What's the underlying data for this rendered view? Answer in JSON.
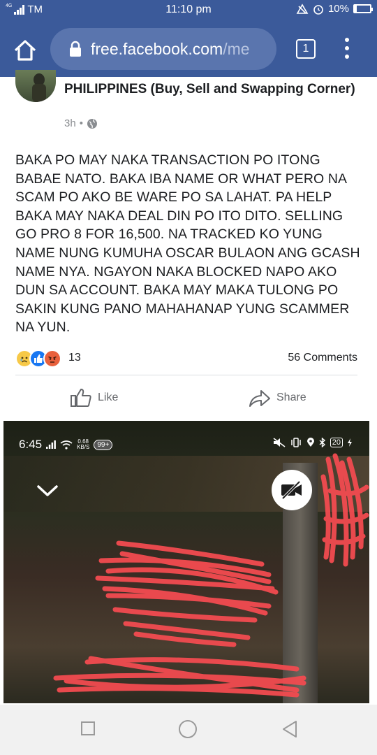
{
  "status_bar": {
    "network_badge": "4G",
    "carrier": "TM",
    "time": "11:10 pm",
    "battery": "10%",
    "icons": [
      "signal-icon",
      "data-saver-icon",
      "alarm-icon",
      "battery-icon"
    ]
  },
  "browser": {
    "url_host": "free.facebook.com",
    "url_rest": "/me",
    "tab_count": "1",
    "icons": [
      "home-icon",
      "lock-icon",
      "tabs-icon",
      "more-vert-icon"
    ]
  },
  "post": {
    "group_name": "PHILIPPINES (Buy, Sell and Swapping Corner)",
    "time_ago": "3h",
    "separator": "•",
    "body": "BAKA PO MAY NAKA TRANSACTION PO ITONG BABAE NATO. BAKA IBA NAME OR WHAT PERO NA SCAM PO AKO BE WARE PO SA LAHAT. PA HELP BAKA MAY NAKA DEAL DIN PO ITO DITO. SELLING GO PRO 8 FOR 16,500. NA TRACKED KO YUNG NAME NUNG KUMUHA OSCAR BULAON ANG GCASH NAME NYA. NGAYON NAKA BLOCKED NAPO AKO DUN SA ACCOUNT. BAKA MAY MAKA TULONG PO SAKIN KUNG PANO MAHAHANAP YUNG SCAMMER NA YUN.",
    "reaction_count": "13",
    "comments": "56 Comments",
    "like_label": "Like",
    "share_label": "Share",
    "reaction_icons": [
      "sad-icon",
      "like-icon",
      "angry-icon"
    ]
  },
  "screenshot_image": {
    "time": "6:45",
    "speed_value": "0.68",
    "speed_unit": "KB/S",
    "notif_badge": "99+",
    "battery": "20",
    "icons": [
      "mute-icon",
      "vibrate-icon",
      "location-icon",
      "bluetooth-icon",
      "chevron-down-icon",
      "video-off-icon"
    ]
  },
  "colors": {
    "facebook_blue": "#3b5a9a",
    "url_bar": "#5a75ae",
    "scribble_red": "#f24b50",
    "text_dark": "#1c1e21",
    "text_gray": "#65676b"
  },
  "nav": {
    "icons": [
      "recents-icon",
      "home-circle-icon",
      "back-icon"
    ]
  }
}
